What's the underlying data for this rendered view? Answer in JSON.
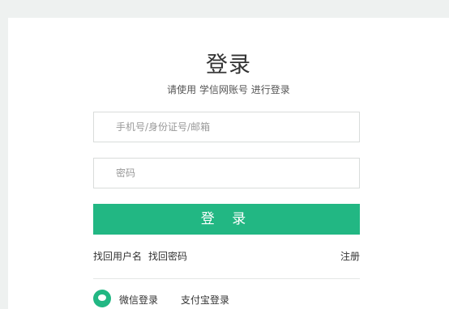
{
  "login": {
    "title": "登录",
    "subtitle": "请使用 学信网账号 进行登录",
    "account_placeholder": "手机号/身份证号/邮箱",
    "password_placeholder": "密码",
    "submit_label": "登 录",
    "find_username_label": "找回用户名",
    "find_password_label": "找回密码",
    "register_label": "注册"
  },
  "alternatives": {
    "wechat_label": "微信登录",
    "alipay_label": "支付宝登录",
    "accent_color": "#22b783"
  }
}
